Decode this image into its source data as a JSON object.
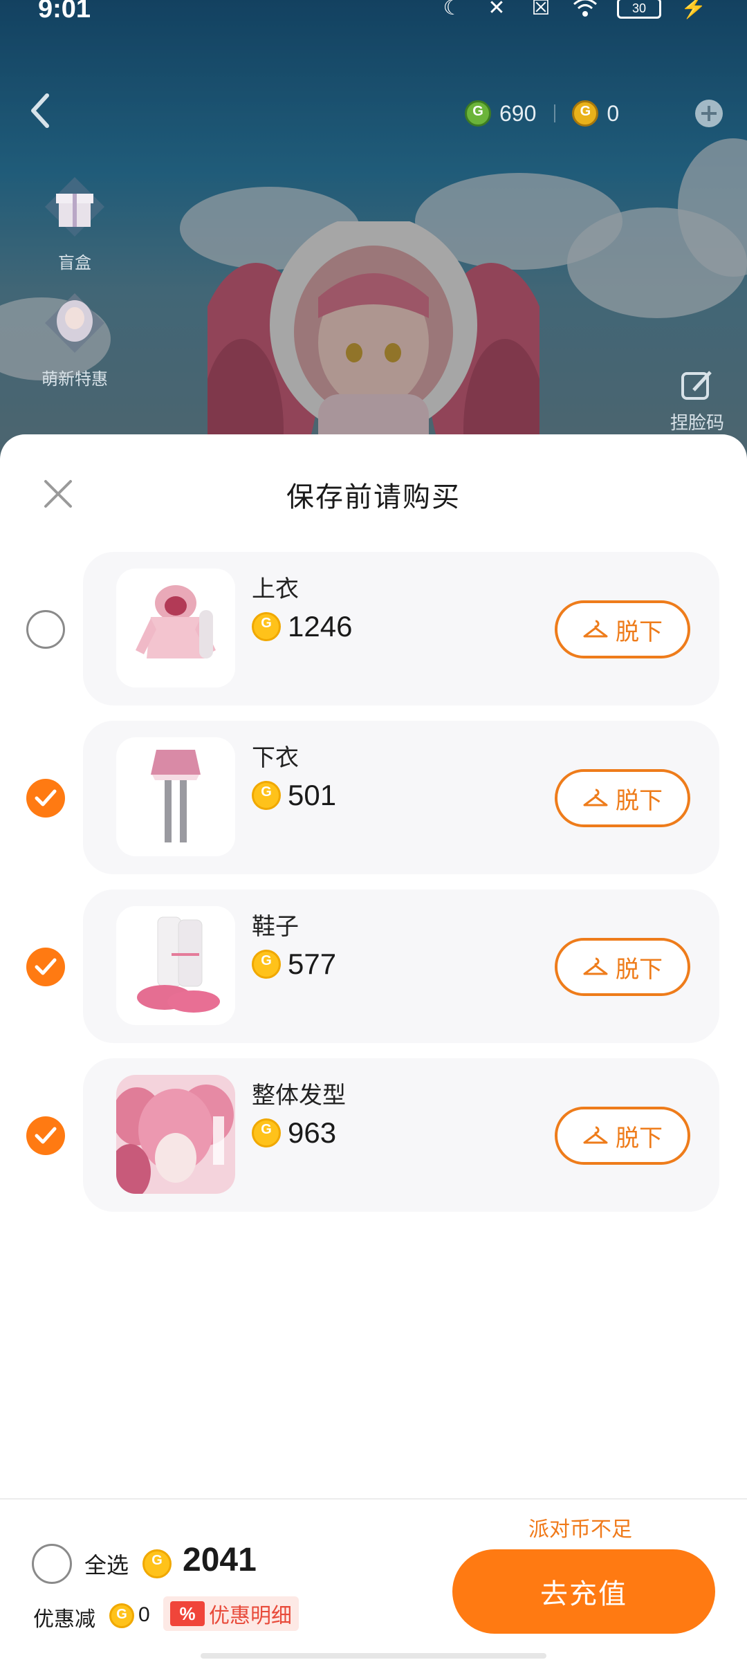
{
  "status_bar": {
    "time": "9:01",
    "battery": "30",
    "icons": [
      "moon-icon",
      "vibrate-off-icon",
      "sim-off-icon",
      "wifi-icon",
      "battery-icon",
      "charging-icon"
    ]
  },
  "top_bar": {
    "currency_green": "690",
    "currency_gold": "0"
  },
  "side_entries": {
    "blind_box": "盲盒",
    "newbie_deal": "萌新特惠"
  },
  "face_code": "捏脸码",
  "sheet": {
    "title": "保存前请购买",
    "items": [
      {
        "name": "上衣",
        "price": "1246",
        "checked": false,
        "action": "脱下"
      },
      {
        "name": "下衣",
        "price": "501",
        "checked": true,
        "action": "脱下"
      },
      {
        "name": "鞋子",
        "price": "577",
        "checked": true,
        "action": "脱下"
      },
      {
        "name": "整体发型",
        "price": "963",
        "checked": true,
        "action": "脱下"
      }
    ]
  },
  "footer": {
    "insufficient": "派对币不足",
    "select_all": "全选",
    "total": "2041",
    "discount_label": "优惠减",
    "discount_value": "0",
    "discount_tag": "%",
    "discount_detail": "优惠明细",
    "recharge": "去充值"
  },
  "colors": {
    "accent": "#ff7a12",
    "accent_border": "#ee7c1b",
    "coin_gold": "#ffc21a",
    "coin_green": "#6bb43a",
    "discount_red": "#f0453a"
  }
}
